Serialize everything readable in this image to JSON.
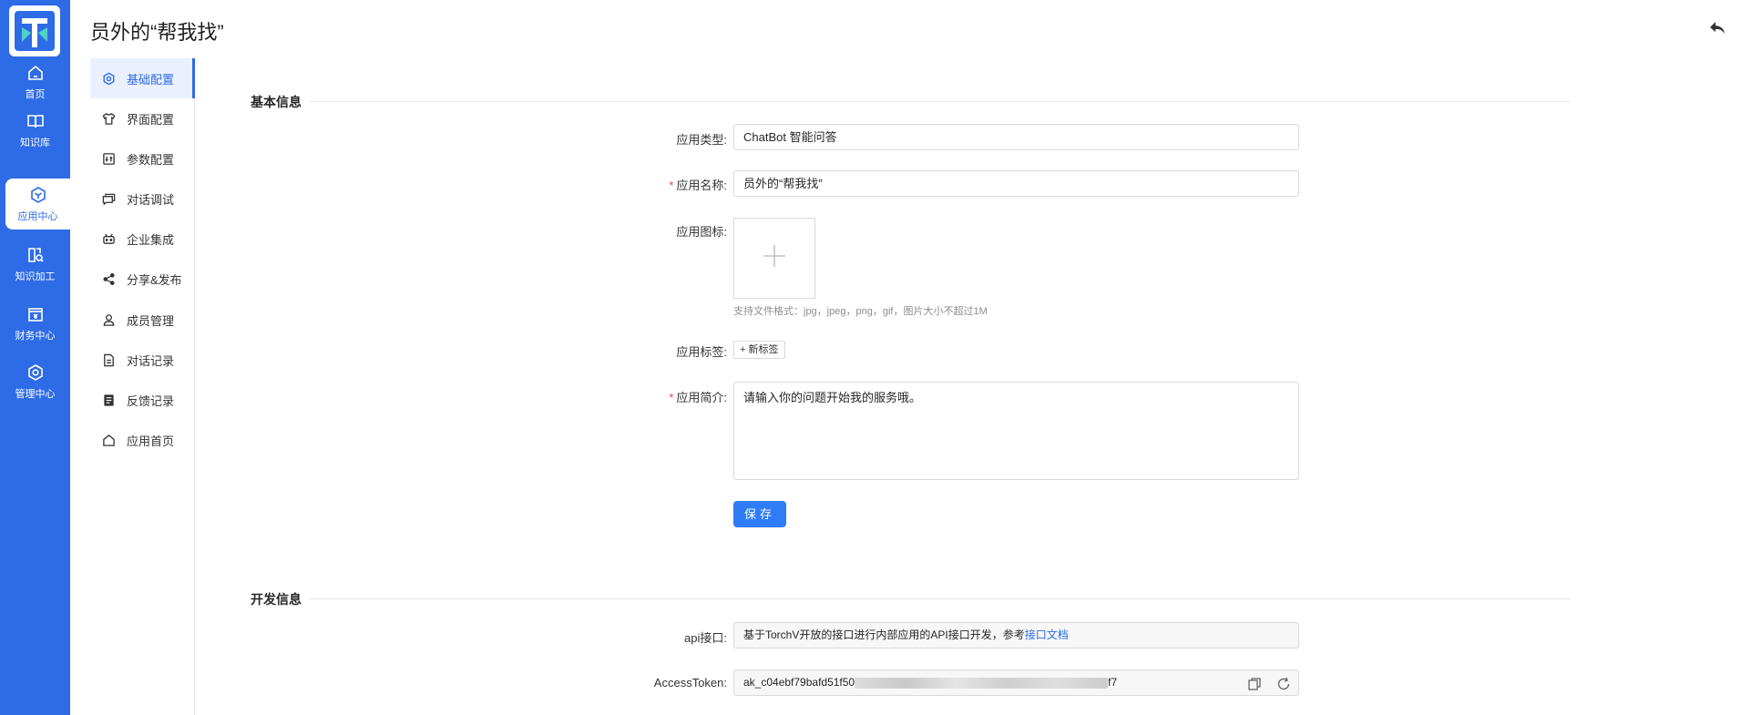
{
  "rail": {
    "items": [
      {
        "label": "首页",
        "icon": "home-icon"
      },
      {
        "label": "知识库",
        "icon": "book-icon"
      },
      {
        "label": "应用中心",
        "icon": "app-cube-icon"
      },
      {
        "label": "知识加工",
        "icon": "document-search-icon"
      },
      {
        "label": "财务中心",
        "icon": "finance-icon"
      },
      {
        "label": "管理中心",
        "icon": "settings-icon"
      }
    ]
  },
  "header": {
    "title": "员外的“帮我找”"
  },
  "subnav": {
    "items": [
      {
        "label": "基础配置",
        "icon": "gear-icon"
      },
      {
        "label": "界面配置",
        "icon": "shirt-icon"
      },
      {
        "label": "参数配置",
        "icon": "parameter-icon"
      },
      {
        "label": "对话调试",
        "icon": "chat-icon"
      },
      {
        "label": "企业集成",
        "icon": "robot-icon"
      },
      {
        "label": "分享&发布",
        "icon": "share-icon"
      },
      {
        "label": "成员管理",
        "icon": "user-icon"
      },
      {
        "label": "对话记录",
        "icon": "file-icon"
      },
      {
        "label": "反馈记录",
        "icon": "feedback-icon"
      },
      {
        "label": "应用首页",
        "icon": "home-icon"
      }
    ]
  },
  "basic": {
    "section_title": "基本信息",
    "type_label": "应用类型:",
    "type_value": "ChatBot 智能问答",
    "name_label": "应用名称:",
    "name_value": "员外的“帮我找”",
    "icon_label": "应用图标:",
    "icon_hint": "支持文件格式：jpg，jpeg，png，gif，图片大小不超过1M",
    "tags_label": "应用标签:",
    "new_tag": "新标签",
    "intro_label": "应用简介:",
    "intro_value": "请输入你的问题开始我的服务哦。",
    "save": "保存"
  },
  "dev": {
    "section_title": "开发信息",
    "api_label": "api接口:",
    "api_text": "基于TorchV开放的接口进行内部应用的API接口开发，参考",
    "api_link": "接口文档",
    "token_label": "AccessToken:",
    "token_prefix": "ak_c04ebf79bafd51f50",
    "token_suffix": "f7"
  },
  "colors": {
    "primary": "#2e6be6",
    "required": "#e5484d"
  }
}
